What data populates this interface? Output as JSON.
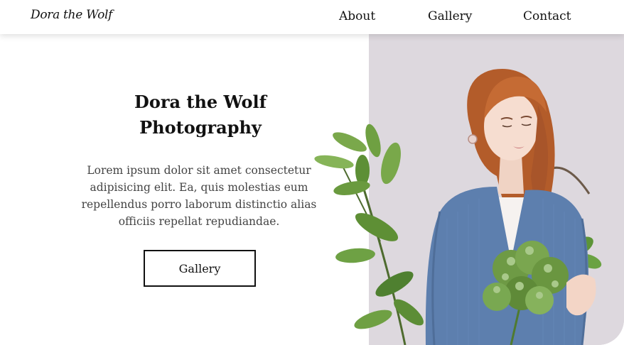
{
  "brand": {
    "logo_text": "Dora the Wolf"
  },
  "nav": {
    "items": [
      {
        "label": "About"
      },
      {
        "label": "Gallery"
      },
      {
        "label": "Contact"
      }
    ]
  },
  "hero": {
    "title_line1": "Dora the Wolf",
    "title_line2": "Photography",
    "description": "Lorem ipsum dolor sit amet consectetur adipisicing elit. Ea, quis molestias eum repellendus porro laborum distinctio alias officiis repellat repudiandae.",
    "button_label": "Gallery"
  },
  "photo": {
    "subject": "portrait-woman-with-plants"
  },
  "colors": {
    "photo_background": "#ddd8de",
    "sweater": "#5d7fae",
    "hair": "#b9632f",
    "leaves": "#5f8f3b"
  }
}
